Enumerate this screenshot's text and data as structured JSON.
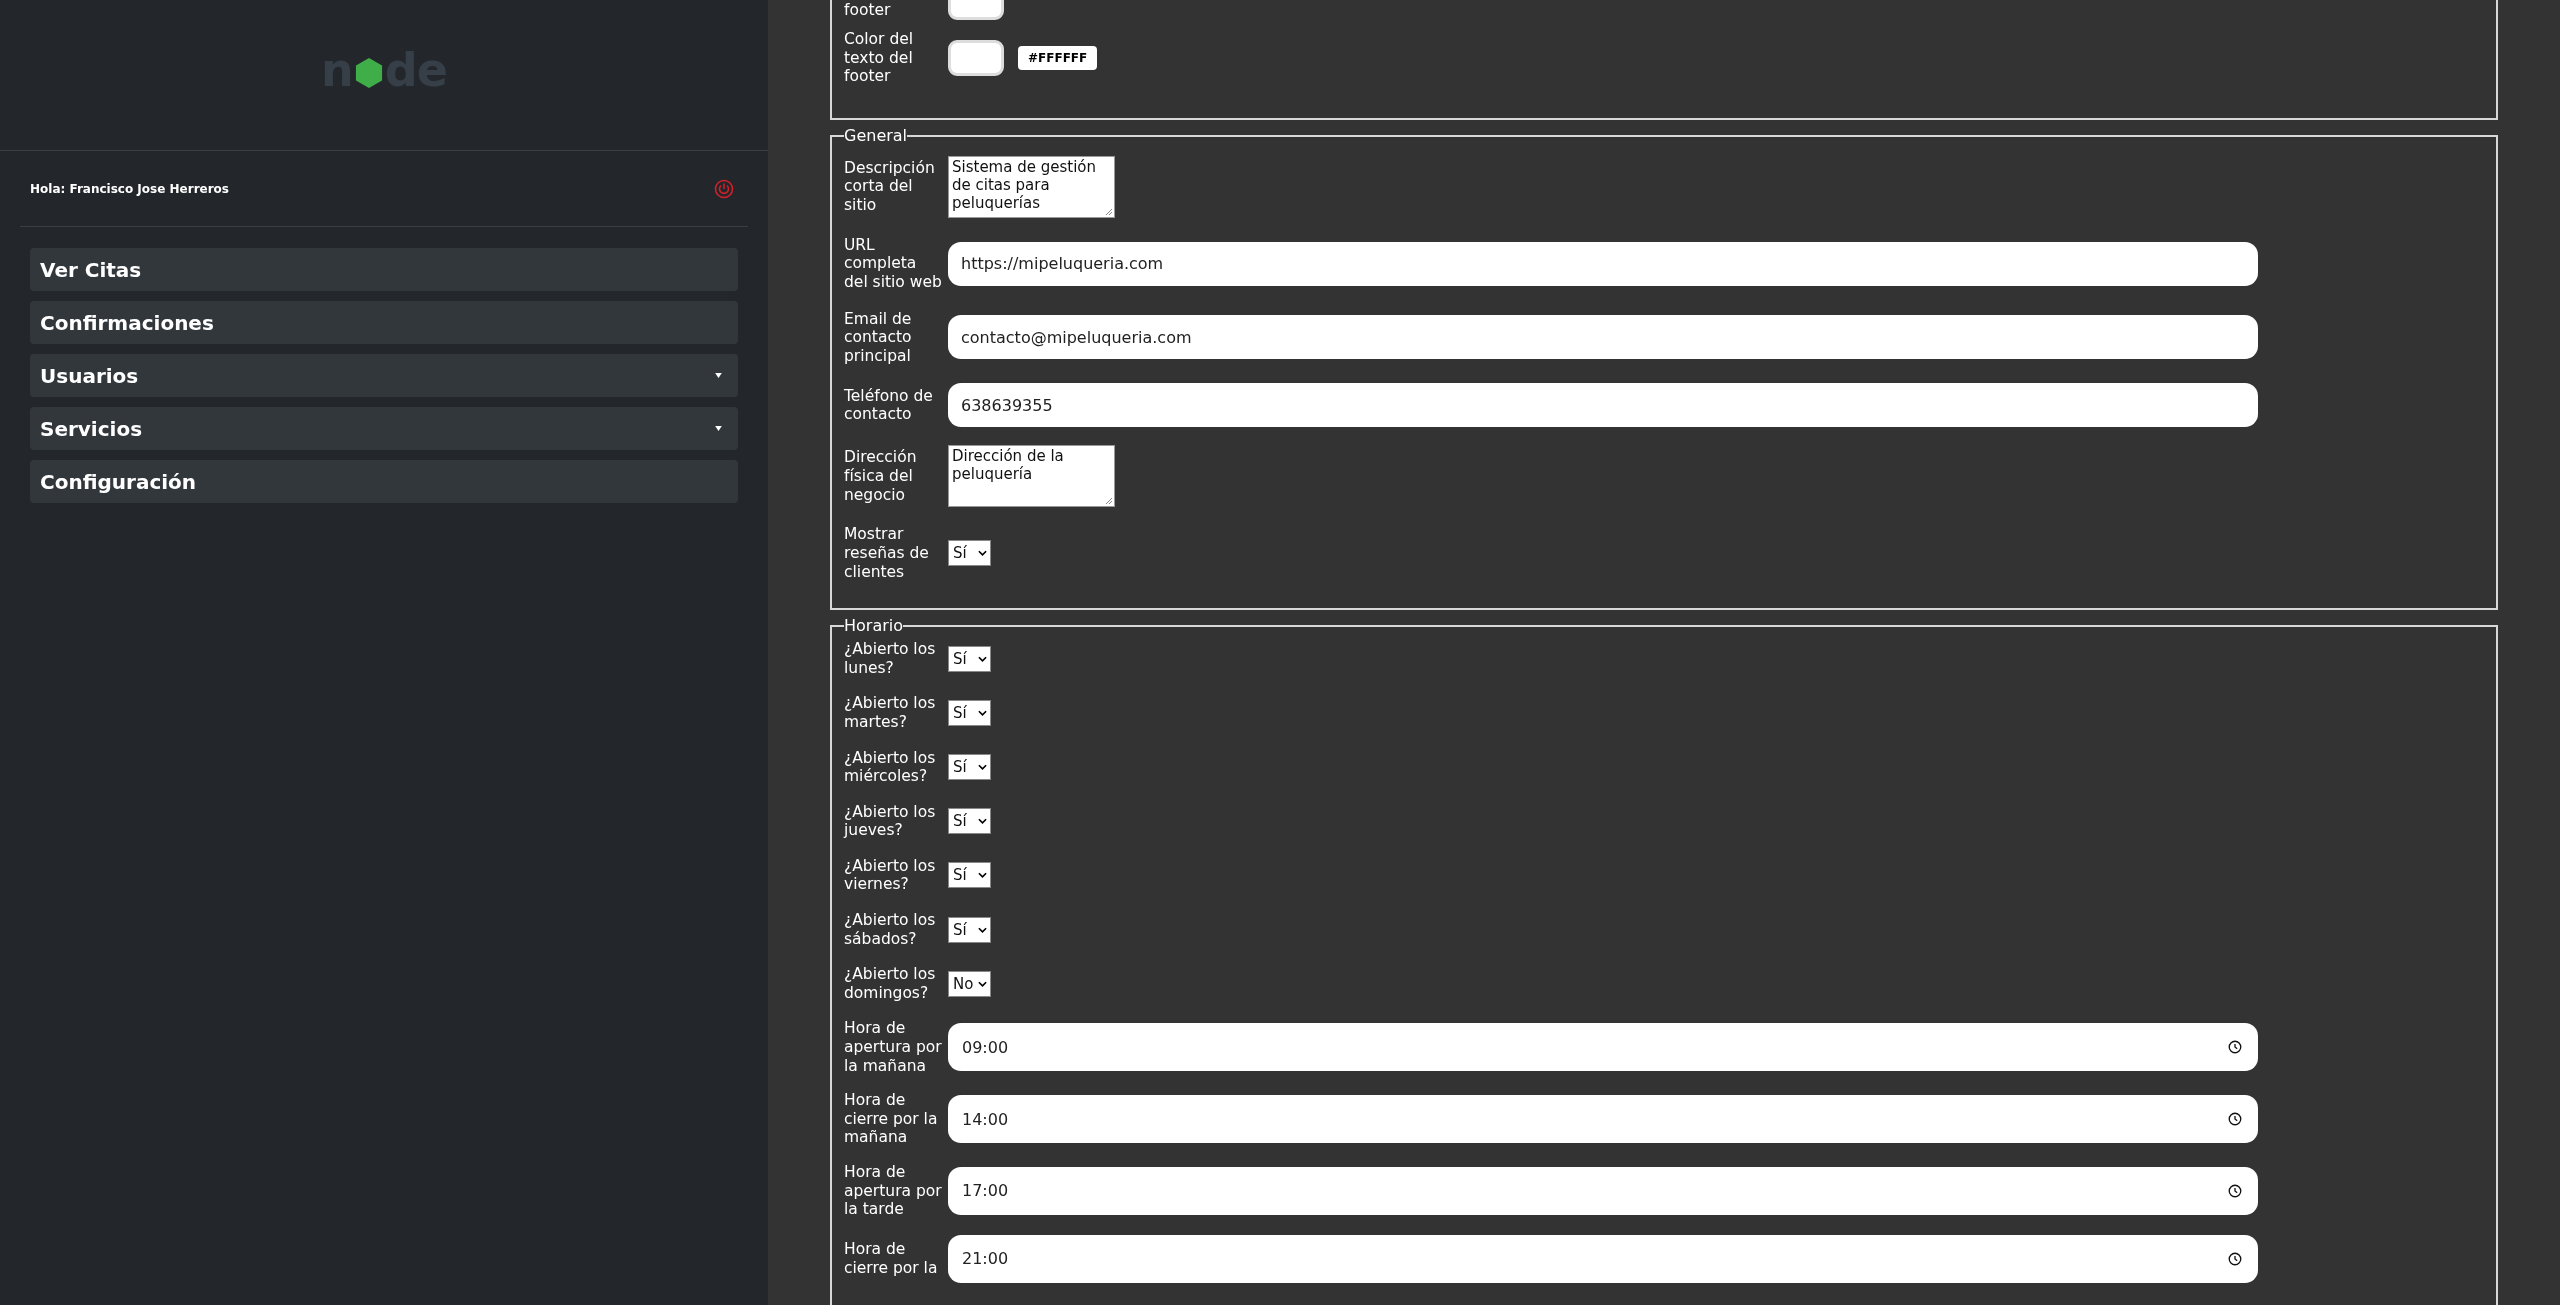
{
  "sidebar": {
    "logo": {
      "left": "n",
      "right": "de"
    },
    "greeting": "Hola: Francisco Jose Herreros",
    "menu": [
      {
        "label": "Ver Citas",
        "has_submenu": false
      },
      {
        "label": "Confirmaciones",
        "has_submenu": false
      },
      {
        "label": "Usuarios",
        "has_submenu": true
      },
      {
        "label": "Servicios",
        "has_submenu": true
      },
      {
        "label": "Configuración",
        "has_submenu": false
      }
    ]
  },
  "sections": [
    {
      "fields": [
        {
          "label": "footer",
          "kind": "color"
        },
        {
          "label": "Color del texto del footer",
          "kind": "color",
          "value": "#FFFFFF"
        }
      ]
    },
    {
      "legend": "General",
      "fields": [
        {
          "label": "Descripción corta del sitio",
          "kind": "textarea",
          "value": "Sistema de gestión de citas para peluquerías"
        },
        {
          "label": "URL completa del sitio web",
          "kind": "text",
          "value": "https://mipeluqueria.com"
        },
        {
          "label": "Email de contacto principal",
          "kind": "text",
          "value": "contacto@mipeluqueria.com"
        },
        {
          "label": "Teléfono de contacto",
          "kind": "text",
          "value": "638639355"
        },
        {
          "label": "Dirección física del negocio",
          "kind": "textarea",
          "value": "Dirección de la peluquería"
        },
        {
          "label": "Mostrar reseñas de clientes",
          "kind": "select",
          "value": "Sí"
        }
      ]
    },
    {
      "legend": "Horario",
      "fields": [
        {
          "label": "¿Abierto los lunes?",
          "kind": "select",
          "value": "Sí"
        },
        {
          "label": "¿Abierto los martes?",
          "kind": "select",
          "value": "Sí"
        },
        {
          "label": "¿Abierto los miércoles?",
          "kind": "select",
          "value": "Sí"
        },
        {
          "label": "¿Abierto los jueves?",
          "kind": "select",
          "value": "Sí"
        },
        {
          "label": "¿Abierto los viernes?",
          "kind": "select",
          "value": "Sí"
        },
        {
          "label": "¿Abierto los sábados?",
          "kind": "select",
          "value": "Sí"
        },
        {
          "label": "¿Abierto los domingos?",
          "kind": "select",
          "value": "No"
        },
        {
          "label": "Hora de apertura por la mañana",
          "kind": "time",
          "value": "09:00"
        },
        {
          "label": "Hora de cierre por la mañana",
          "kind": "time",
          "value": "14:00"
        },
        {
          "label": "Hora de apertura por la tarde",
          "kind": "time",
          "value": "17:00"
        },
        {
          "label": "Hora de cierre por la",
          "kind": "time",
          "value": "21:00"
        }
      ]
    }
  ]
}
